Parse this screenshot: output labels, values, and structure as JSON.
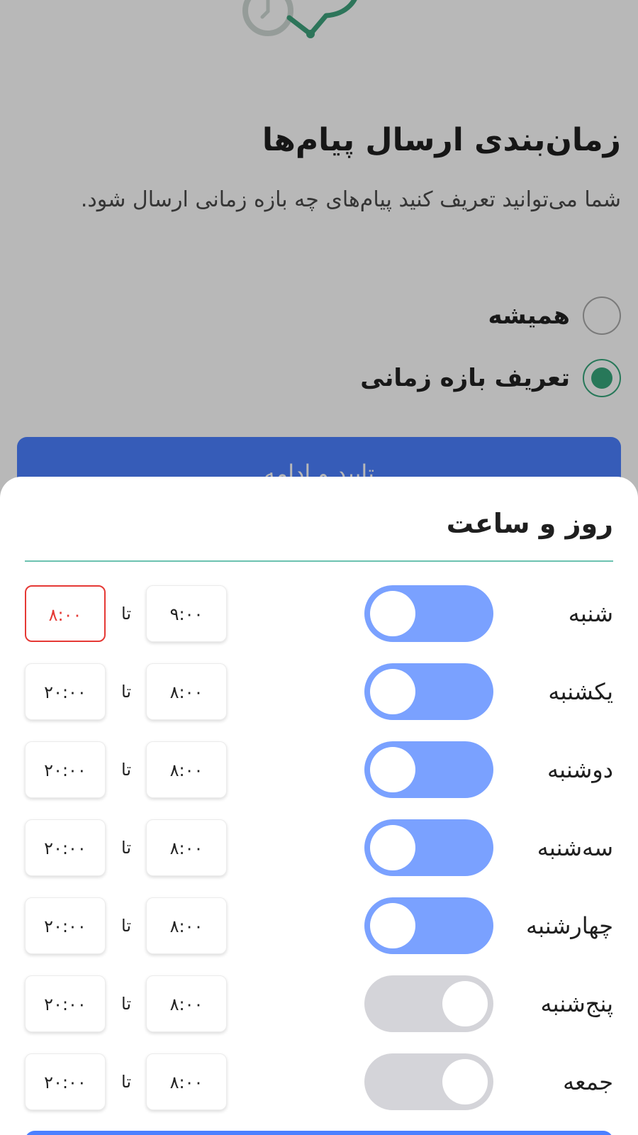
{
  "background": {
    "title": "زمان‌بندی ارسال پیام‌ها",
    "description": "شما می‌توانید تعریف کنید  پیام‌های چه بازه زمانی ارسال شود.",
    "options": [
      {
        "label": "همیشه",
        "selected": false
      },
      {
        "label": "تعریف بازه زمانی",
        "selected": true
      }
    ],
    "continue_label": "تایید و ادامه"
  },
  "sheet": {
    "title": "روز و ساعت",
    "to_label": "تا",
    "days": [
      {
        "name": "شنبه",
        "enabled": true,
        "from": "۹:۰۰",
        "to": "۸:۰۰",
        "to_error": true
      },
      {
        "name": "یکشنبه",
        "enabled": true,
        "from": "۸:۰۰",
        "to": "۲۰:۰۰",
        "to_error": false
      },
      {
        "name": "دوشنبه",
        "enabled": true,
        "from": "۸:۰۰",
        "to": "۲۰:۰۰",
        "to_error": false
      },
      {
        "name": "سه‌شنبه",
        "enabled": true,
        "from": "۸:۰۰",
        "to": "۲۰:۰۰",
        "to_error": false
      },
      {
        "name": "چهارشنبه",
        "enabled": true,
        "from": "۸:۰۰",
        "to": "۲۰:۰۰",
        "to_error": false
      },
      {
        "name": "پنج‌شنبه",
        "enabled": false,
        "from": "۸:۰۰",
        "to": "۲۰:۰۰",
        "to_error": false
      },
      {
        "name": "جمعه",
        "enabled": false,
        "from": "۸:۰۰",
        "to": "۲۰:۰۰",
        "to_error": false
      }
    ]
  },
  "colors": {
    "accent_blue": "#4c80ff",
    "toggle_on": "#7aa1ff",
    "toggle_off": "#d4d4d9",
    "radio_green": "#37a77c",
    "error_red": "#e53935",
    "divider_teal": "#6cc2b0"
  },
  "icons": {
    "hero": "clock-chat-bubble-icon"
  }
}
